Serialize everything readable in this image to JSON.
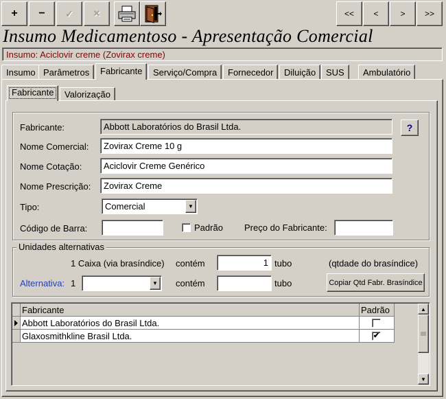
{
  "toolbar": {
    "add": "+",
    "remove": "−",
    "confirm": "✓",
    "cancel": "✕",
    "first": "<<",
    "prev": "<",
    "next": ">",
    "last": ">>"
  },
  "title": "Insumo Medicamentoso - Apresentação Comercial",
  "insumo_line": "Insumo:  Aciclovir creme (Zovirax creme)",
  "main_tabs": [
    "Insumo",
    "Parâmetros",
    "Fabricante",
    "Serviço/Compra",
    "Fornecedor",
    "Diluição",
    "SUS",
    "Ambulatório"
  ],
  "sub_tabs": [
    "Fabricante",
    "Valorização"
  ],
  "form": {
    "fabricante_label": "Fabricante:",
    "fabricante_value": "Abbott Laboratórios do Brasil Ltda.",
    "help": "?",
    "nome_comercial_label": "Nome Comercial:",
    "nome_comercial_value": "Zovirax Creme 10 g",
    "nome_cotacao_label": "Nome Cotação:",
    "nome_cotacao_value": "Aciclovir Creme Genérico",
    "nome_prescricao_label": "Nome Prescrição:",
    "nome_prescricao_value": "Zovirax Creme",
    "tipo_label": "Tipo:",
    "tipo_value": "Comercial",
    "codigo_label": "Código de Barra:",
    "codigo_value": "",
    "padrao_label": "Padrão",
    "preco_label": "Preço do Fabricante:",
    "preco_value": ""
  },
  "unidades": {
    "legend": "Unidades alternativas",
    "row1_left": "1 Caixa (via brasíndice)",
    "contem1": "contém",
    "qty1": "1",
    "unit1": "tubo",
    "qtdade_note": "(qtdade do brasíndice)",
    "alt_label": "Alternativa:",
    "alt_num": "1",
    "alt_select": "",
    "contem2": "contém",
    "qty2": "",
    "unit2": "tubo",
    "copy_button": "Copiar Qtd Fabr. Brasíndice"
  },
  "grid": {
    "headers": [
      "Fabricante",
      "Padrão"
    ],
    "rows": [
      {
        "fabricante": "Abbott Laboratórios do Brasil Ltda.",
        "padrao": ""
      },
      {
        "fabricante": "Glaxosmithkline Brasil Ltda.",
        "padrao": "✔"
      }
    ],
    "scroll_up": "▲",
    "scroll_down": "▼"
  }
}
